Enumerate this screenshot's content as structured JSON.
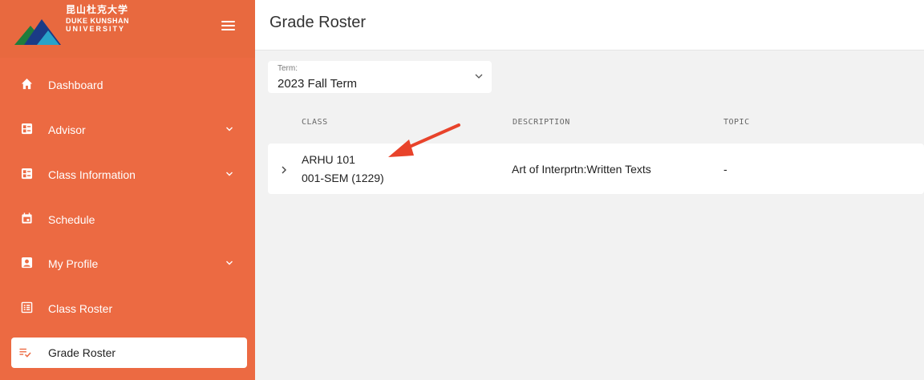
{
  "brand": {
    "name_cn": "昆山杜克大学",
    "name_en_line1": "DUKE KUNSHAN",
    "name_en_line2": "UNIVERSITY"
  },
  "sidebar": {
    "items": [
      {
        "label": "Dashboard",
        "icon": "home-icon",
        "expandable": false
      },
      {
        "label": "Advisor",
        "icon": "advisor-icon",
        "expandable": true
      },
      {
        "label": "Class Information",
        "icon": "class-info-icon",
        "expandable": true
      },
      {
        "label": "Schedule",
        "icon": "calendar-icon",
        "expandable": false
      },
      {
        "label": "My Profile",
        "icon": "profile-icon",
        "expandable": true
      },
      {
        "label": "Class Roster",
        "icon": "roster-icon",
        "expandable": false
      },
      {
        "label": "Grade Roster",
        "icon": "grade-roster-icon",
        "expandable": false,
        "active": true
      }
    ]
  },
  "header": {
    "title": "Grade Roster"
  },
  "term": {
    "label": "Term:",
    "value": "2023 Fall Term"
  },
  "table": {
    "columns": [
      "CLASS",
      "DESCRIPTION",
      "TOPIC"
    ],
    "rows": [
      {
        "class_code": "ARHU 101",
        "section": "001-SEM (1229)",
        "description": "Art of Interprtn:Written Texts",
        "topic": "-"
      }
    ]
  },
  "colors": {
    "sidebar": "#ec6a42",
    "annotation_arrow": "#e8432b",
    "background": "#f2f2f2"
  }
}
